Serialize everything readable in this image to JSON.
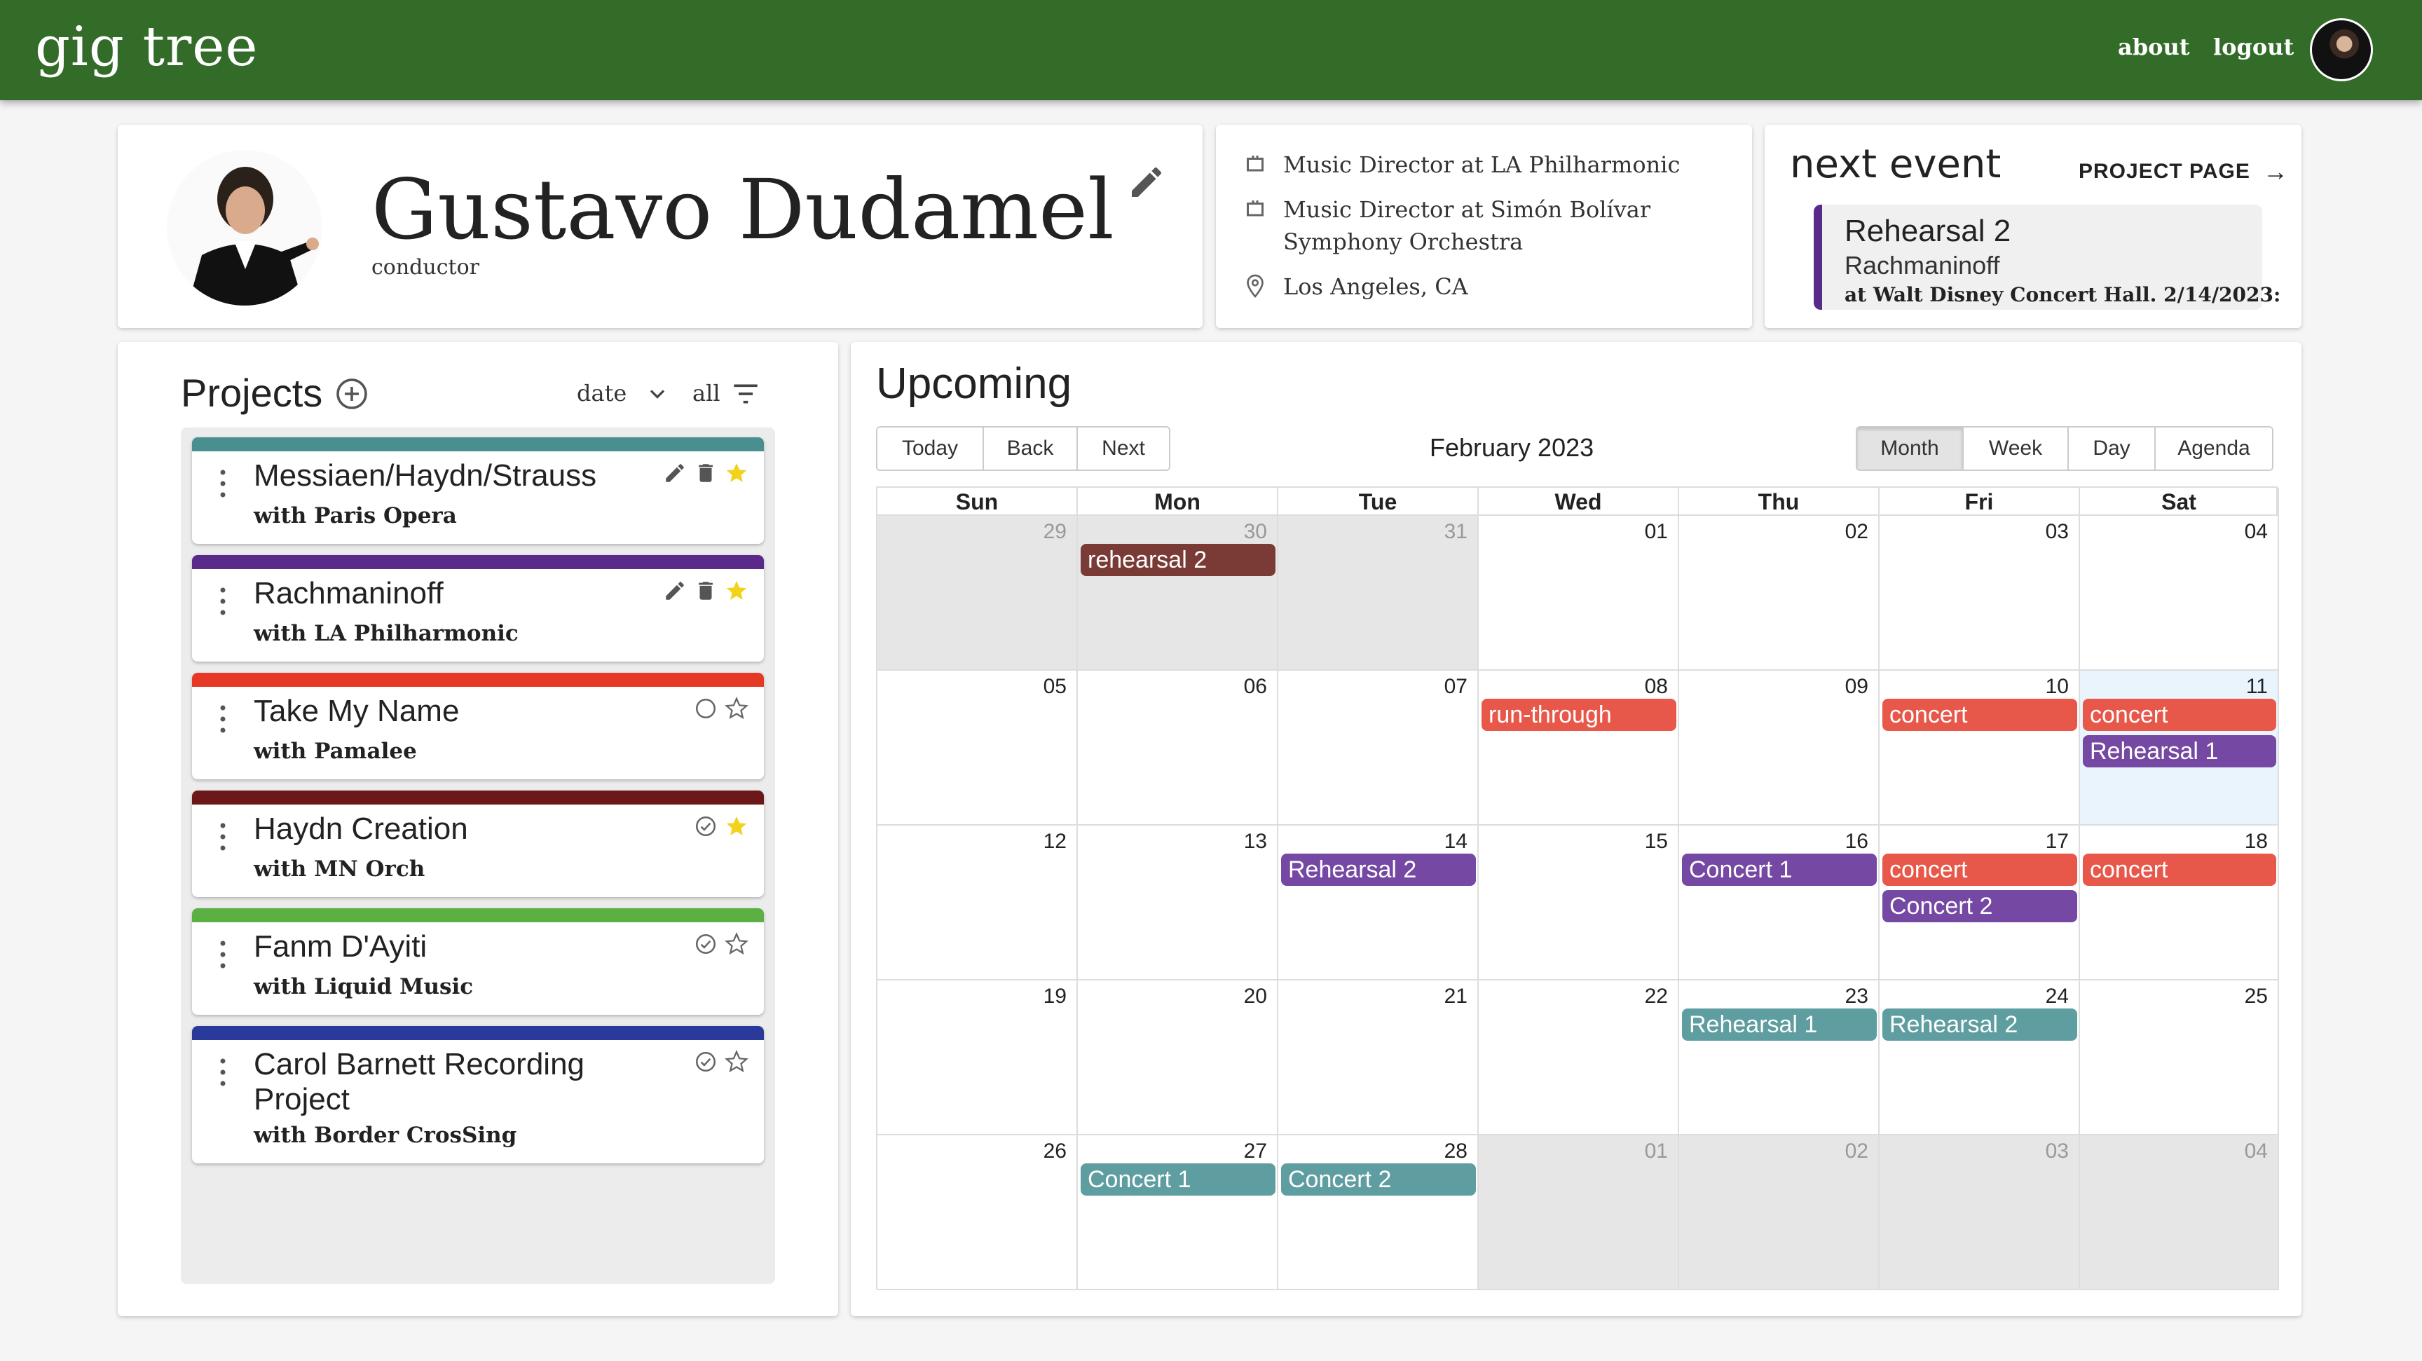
{
  "header": {
    "brand": "gig tree",
    "nav": {
      "about": "about",
      "logout": "logout"
    },
    "bg_color": "#336b28"
  },
  "profile": {
    "name": "Gustavo Dudamel",
    "role": "conductor",
    "details": [
      {
        "icon": "briefcase-icon",
        "text": "Music Director at LA Philharmonic"
      },
      {
        "icon": "briefcase-icon",
        "text": "Music Director at Simón Bolívar Symphony Orchestra"
      },
      {
        "icon": "location-pin-icon",
        "text": "Los Angeles, CA"
      }
    ]
  },
  "next_event": {
    "title": "next event",
    "link": "PROJECT PAGE",
    "event_title": "Rehearsal 2",
    "event_project": "Rachmaninoff",
    "event_where": "at Walt Disney Concert Hall. 2/14/2023:",
    "accent_color": "#5a2a8a"
  },
  "projects": {
    "title": "Projects",
    "sort": "date",
    "filter": "all",
    "items": [
      {
        "name": "Messiaen/Haydn/Strauss",
        "with": "with Paris Opera",
        "color": "#4a8f8f",
        "actions": [
          "pencil-icon",
          "trash-icon",
          "star-filled-icon"
        ]
      },
      {
        "name": "Rachmaninoff",
        "with": "with LA Philharmonic",
        "color": "#5a2a8a",
        "actions": [
          "pencil-icon",
          "trash-icon",
          "star-filled-icon"
        ]
      },
      {
        "name": "Take My Name",
        "with": "with Pamalee",
        "color": "#e53926",
        "actions": [
          "circle-icon",
          "star-outline-icon"
        ]
      },
      {
        "name": "Haydn Creation",
        "with": "with MN Orch",
        "color": "#6b1818",
        "actions": [
          "check-circle-icon",
          "star-filled-icon"
        ]
      },
      {
        "name": "Fanm D'Ayiti",
        "with": "with Liquid Music",
        "color": "#5bb044",
        "actions": [
          "check-circle-icon",
          "star-outline-icon"
        ]
      },
      {
        "name": "Carol Barnett Recording Project",
        "with": "with Border CrosSing",
        "color": "#2a3a9a",
        "actions": [
          "check-circle-icon",
          "star-outline-icon"
        ]
      }
    ]
  },
  "calendar": {
    "title": "Upcoming",
    "nav_buttons": [
      "Today",
      "Back",
      "Next"
    ],
    "month_label": "February 2023",
    "views": [
      "Month",
      "Week",
      "Day",
      "Agenda"
    ],
    "active_view": "Month",
    "weekdays": [
      "Sun",
      "Mon",
      "Tue",
      "Wed",
      "Thu",
      "Fri",
      "Sat"
    ],
    "weeks": [
      [
        {
          "d": "29",
          "off": true
        },
        {
          "d": "30",
          "off": true
        },
        {
          "d": "31",
          "off": true
        },
        {
          "d": "01"
        },
        {
          "d": "02"
        },
        {
          "d": "03"
        },
        {
          "d": "04"
        }
      ],
      [
        {
          "d": "05"
        },
        {
          "d": "06"
        },
        {
          "d": "07"
        },
        {
          "d": "08"
        },
        {
          "d": "09"
        },
        {
          "d": "10"
        },
        {
          "d": "11",
          "today": true
        }
      ],
      [
        {
          "d": "12"
        },
        {
          "d": "13"
        },
        {
          "d": "14"
        },
        {
          "d": "15"
        },
        {
          "d": "16"
        },
        {
          "d": "17"
        },
        {
          "d": "18"
        }
      ],
      [
        {
          "d": "19"
        },
        {
          "d": "20"
        },
        {
          "d": "21"
        },
        {
          "d": "22"
        },
        {
          "d": "23"
        },
        {
          "d": "24"
        },
        {
          "d": "25"
        }
      ],
      [
        {
          "d": "26"
        },
        {
          "d": "27"
        },
        {
          "d": "28"
        },
        {
          "d": "01",
          "off": true
        },
        {
          "d": "02",
          "off": true
        },
        {
          "d": "03",
          "off": true
        },
        {
          "d": "04",
          "off": true
        }
      ]
    ],
    "events": [
      {
        "label": "rehearsal 2",
        "week": 0,
        "day": 1,
        "slot": 0,
        "color": "#7a3a35"
      },
      {
        "label": "run-through",
        "week": 1,
        "day": 3,
        "slot": 0,
        "color": "#e8584a"
      },
      {
        "label": "concert",
        "week": 1,
        "day": 5,
        "slot": 0,
        "color": "#e8584a"
      },
      {
        "label": "concert",
        "week": 1,
        "day": 6,
        "slot": 0,
        "color": "#e8584a"
      },
      {
        "label": "Rehearsal 1",
        "week": 1,
        "day": 6,
        "slot": 1,
        "color": "#7548a3"
      },
      {
        "label": "Rehearsal 2",
        "week": 2,
        "day": 2,
        "slot": 0,
        "color": "#7548a3"
      },
      {
        "label": "Concert 1",
        "week": 2,
        "day": 4,
        "slot": 0,
        "color": "#7548a3"
      },
      {
        "label": "concert",
        "week": 2,
        "day": 5,
        "slot": 0,
        "color": "#e8584a"
      },
      {
        "label": "Concert 2",
        "week": 2,
        "day": 5,
        "slot": 1,
        "color": "#7548a3"
      },
      {
        "label": "concert",
        "week": 2,
        "day": 6,
        "slot": 0,
        "color": "#e8584a"
      },
      {
        "label": "Rehearsal 1",
        "week": 3,
        "day": 4,
        "slot": 0,
        "color": "#5e9da0"
      },
      {
        "label": "Rehearsal 2",
        "week": 3,
        "day": 5,
        "slot": 0,
        "color": "#5e9da0"
      },
      {
        "label": "Concert 1",
        "week": 4,
        "day": 1,
        "slot": 0,
        "color": "#5e9da0"
      },
      {
        "label": "Concert 2",
        "week": 4,
        "day": 2,
        "slot": 0,
        "color": "#5e9da0"
      }
    ]
  }
}
